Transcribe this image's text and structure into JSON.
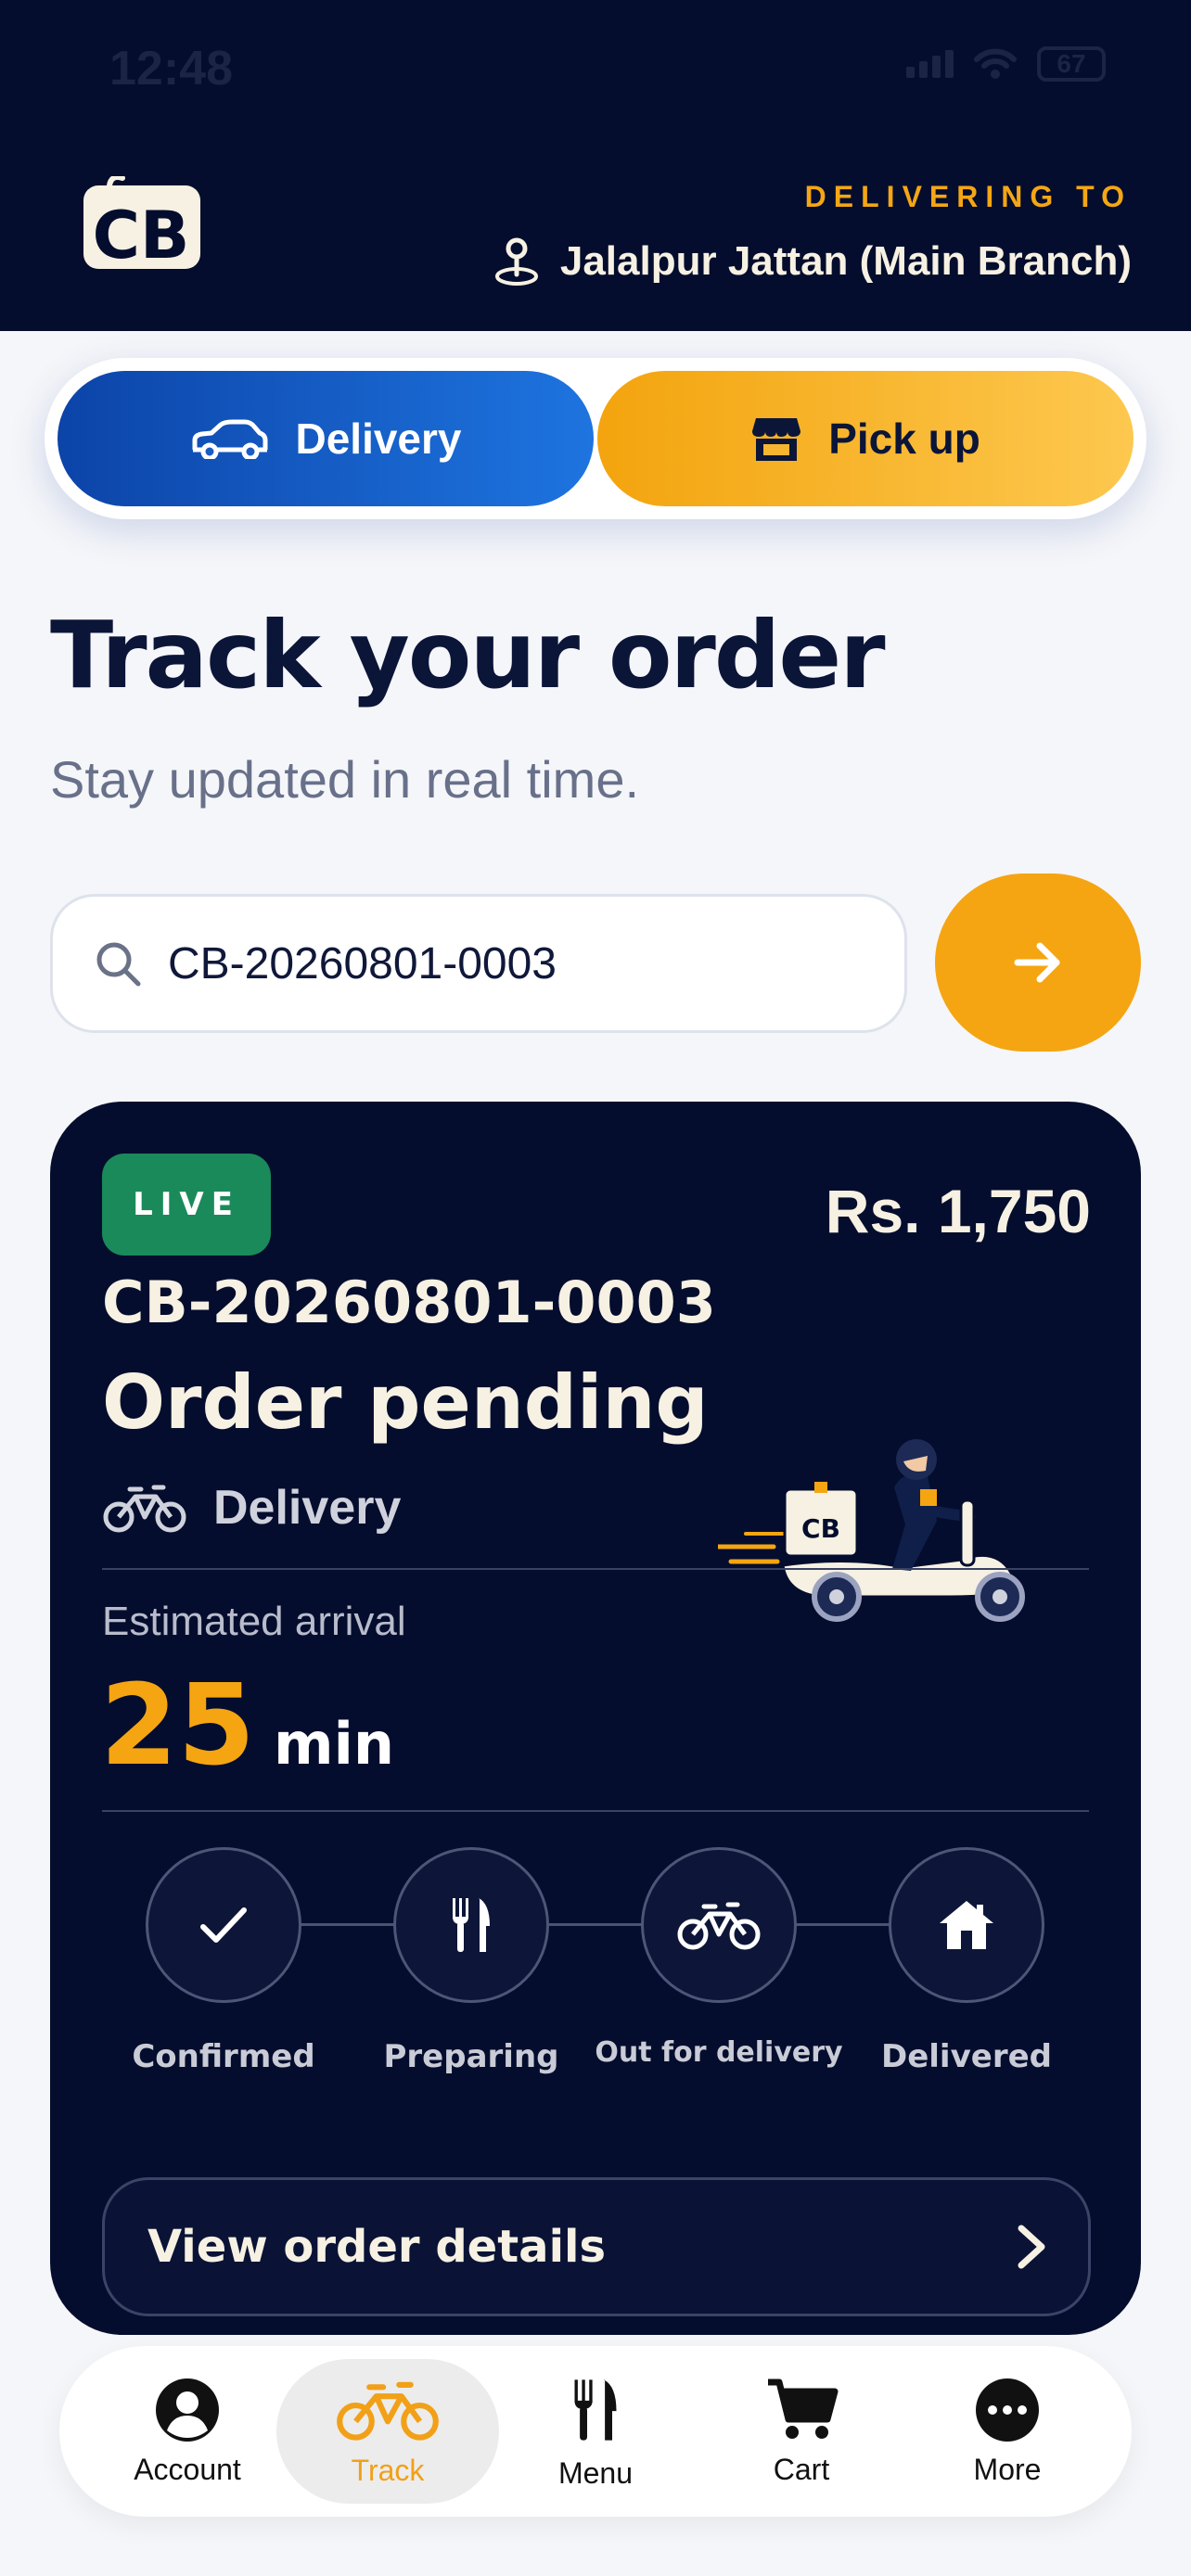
{
  "status_bar": {
    "time": "12:48",
    "battery": "67"
  },
  "header": {
    "logo_text": "CB",
    "delivering_label": "DELIVERING TO",
    "branch_name": "Jalalpur Jattan (Main Branch)"
  },
  "mode_toggle": {
    "delivery_label": "Delivery",
    "pickup_label": "Pick up",
    "selected": "Delivery"
  },
  "page": {
    "title": "Track your order",
    "subtitle": "Stay updated in real time."
  },
  "search": {
    "value": "CB-20260801-0003"
  },
  "order": {
    "badge": "LIVE",
    "price": "Rs. 1,750",
    "id": "CB-20260801-0003",
    "status": "Order pending",
    "mode": "Delivery",
    "eta_label": "Estimated arrival",
    "eta_value": "25",
    "eta_unit": "min",
    "steps": [
      {
        "label": "Confirmed",
        "icon": "check-icon"
      },
      {
        "label": "Preparing",
        "icon": "fork-knife-icon"
      },
      {
        "label": "Out for delivery",
        "icon": "bicycle-icon"
      },
      {
        "label": "Delivered",
        "icon": "house-icon"
      }
    ],
    "details_label": "View order details"
  },
  "bottom_nav": {
    "items": [
      {
        "label": "Account",
        "icon": "account-icon"
      },
      {
        "label": "Track",
        "icon": "bicycle-icon"
      },
      {
        "label": "Menu",
        "icon": "fork-knife-icon"
      },
      {
        "label": "Cart",
        "icon": "cart-icon"
      },
      {
        "label": "More",
        "icon": "more-icon"
      }
    ],
    "active": "Track"
  },
  "colors": {
    "navy": "#050d2e",
    "accent": "#f5a512",
    "delivery_blue": "#1e74e0",
    "live_green": "#1a8a5a",
    "cream": "#f6f1e2"
  }
}
